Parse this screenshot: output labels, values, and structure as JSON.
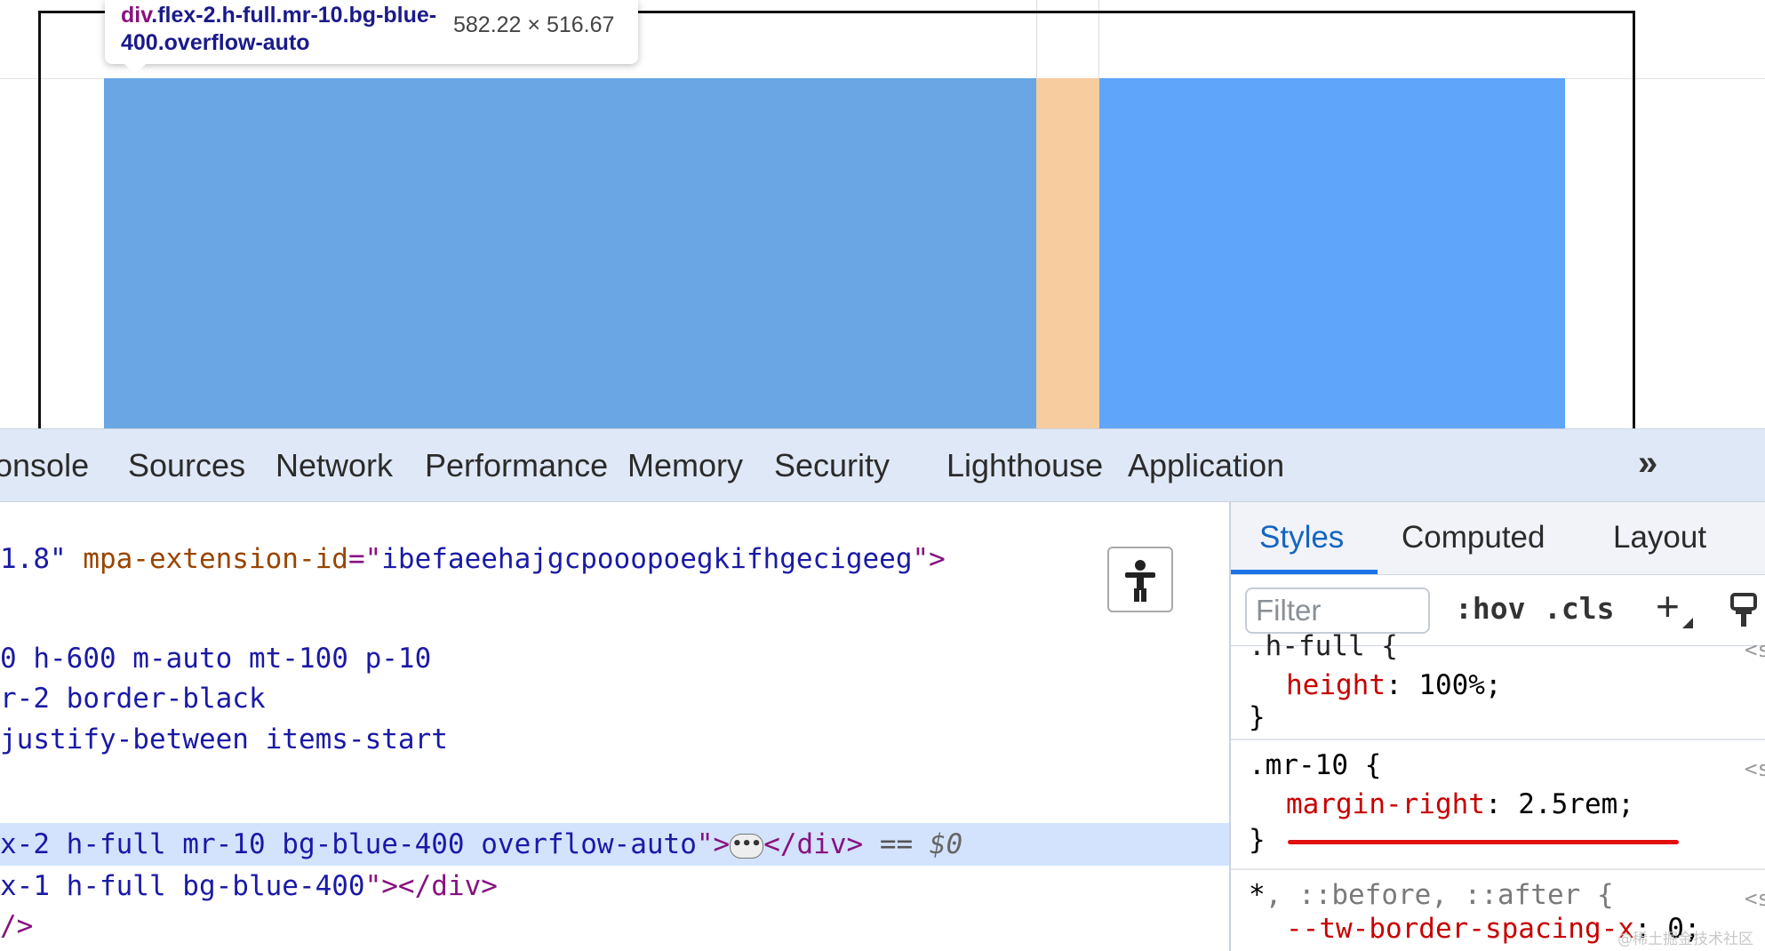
{
  "inspector_tooltip": {
    "selector_tag": "div",
    "selector_classes": ".flex-2.h-full.mr-10.bg-blue-400.overflow-auto",
    "size": "582.22 × 516.67"
  },
  "devtools_tabs": [
    "onsole",
    "Sources",
    "Network",
    "Performance",
    "Memory",
    "Security",
    "Lighthouse",
    "Application"
  ],
  "more_tabs_glyph": "»",
  "elements_panel": {
    "line1_start": "1.8\"",
    "line1_attr": " mpa-extension-id",
    "line1_eq": "=\"",
    "line1_val": "ibefaeehajgcpooopoegkifhgecigeeg",
    "line1_end": "\">",
    "line2": "0 h-600 m-auto mt-100 p-10",
    "line3": "r-2 border-black",
    "line4": "justify-between items-start",
    "selected_val": "x-2 h-full mr-10 bg-blue-400 overflow-auto",
    "selected_close_quote": "\">",
    "selected_ellipsis": "•••",
    "selected_end_tag": "</div>",
    "selected_eq": " == ",
    "selected_dollar": "$0",
    "line6_val": "x-1 h-full bg-blue-400",
    "line6_end": "\"></div>",
    "line7": "/>"
  },
  "styles_sidebar": {
    "tabs": [
      "Styles",
      "Computed",
      "Layout"
    ],
    "active_tab": "Styles",
    "filter_placeholder": "Filter",
    "hov_label": ":hov",
    "cls_label": ".cls",
    "rules": {
      "r1_clipped_selector": ".h-full {",
      "r1_prop": "height",
      "r1_value": "100%;",
      "close_brace": "}",
      "r2_selector": ".mr-10 {",
      "r2_prop": "margin-right",
      "r2_value": "2.5rem;",
      "r3_selector_star": "*",
      "r3_selector_rest": ", ::before, ::after {",
      "r3_prop_clipped": "--tw-border-spacing-x",
      "r3_value_clipped": "0;",
      "src_marker": "<s"
    }
  },
  "colors": {
    "element_blue": "#6aa6e4",
    "sibling_blue": "#5fa5fa",
    "margin_highlight": "#f7cc9e",
    "annotation_red": "#e01010",
    "tab_active": "#1a73e8"
  },
  "watermark": "@稀土掘金技术社区"
}
